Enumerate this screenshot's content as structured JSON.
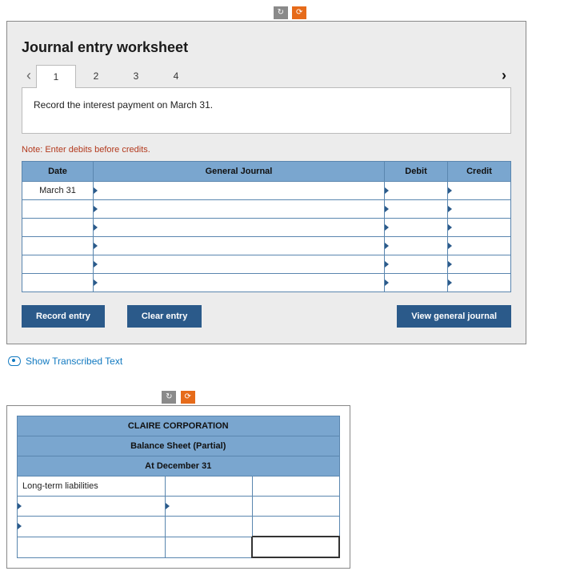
{
  "toolbar": {
    "refresh_glyph": "↻",
    "reload_glyph": "⟳"
  },
  "worksheet": {
    "title": "Journal entry worksheet",
    "nav_prev": "‹",
    "nav_next": "›",
    "tabs": [
      "1",
      "2",
      "3",
      "4"
    ],
    "active_tab_index": 0,
    "prompt": "Record the interest payment on March 31.",
    "note": "Note: Enter debits before credits.",
    "columns": {
      "date": "Date",
      "general_journal": "General Journal",
      "debit": "Debit",
      "credit": "Credit"
    },
    "rows": [
      {
        "date": "March 31",
        "gj": "",
        "debit": "",
        "credit": ""
      },
      {
        "date": "",
        "gj": "",
        "debit": "",
        "credit": ""
      },
      {
        "date": "",
        "gj": "",
        "debit": "",
        "credit": ""
      },
      {
        "date": "",
        "gj": "",
        "debit": "",
        "credit": ""
      },
      {
        "date": "",
        "gj": "",
        "debit": "",
        "credit": ""
      },
      {
        "date": "",
        "gj": "",
        "debit": "",
        "credit": ""
      }
    ],
    "buttons": {
      "record": "Record entry",
      "clear": "Clear entry",
      "view": "View general journal"
    }
  },
  "show_link": "Show Transcribed Text",
  "balance": {
    "header1": "CLAIRE CORPORATION",
    "header2": "Balance Sheet (Partial)",
    "header3": "At December 31",
    "rows": [
      {
        "a": "Long-term liabilities",
        "b": "",
        "c": ""
      },
      {
        "a": "",
        "b": "",
        "c": ""
      },
      {
        "a": "",
        "b": "",
        "c": ""
      },
      {
        "a": "",
        "b": "",
        "c": ""
      }
    ]
  }
}
